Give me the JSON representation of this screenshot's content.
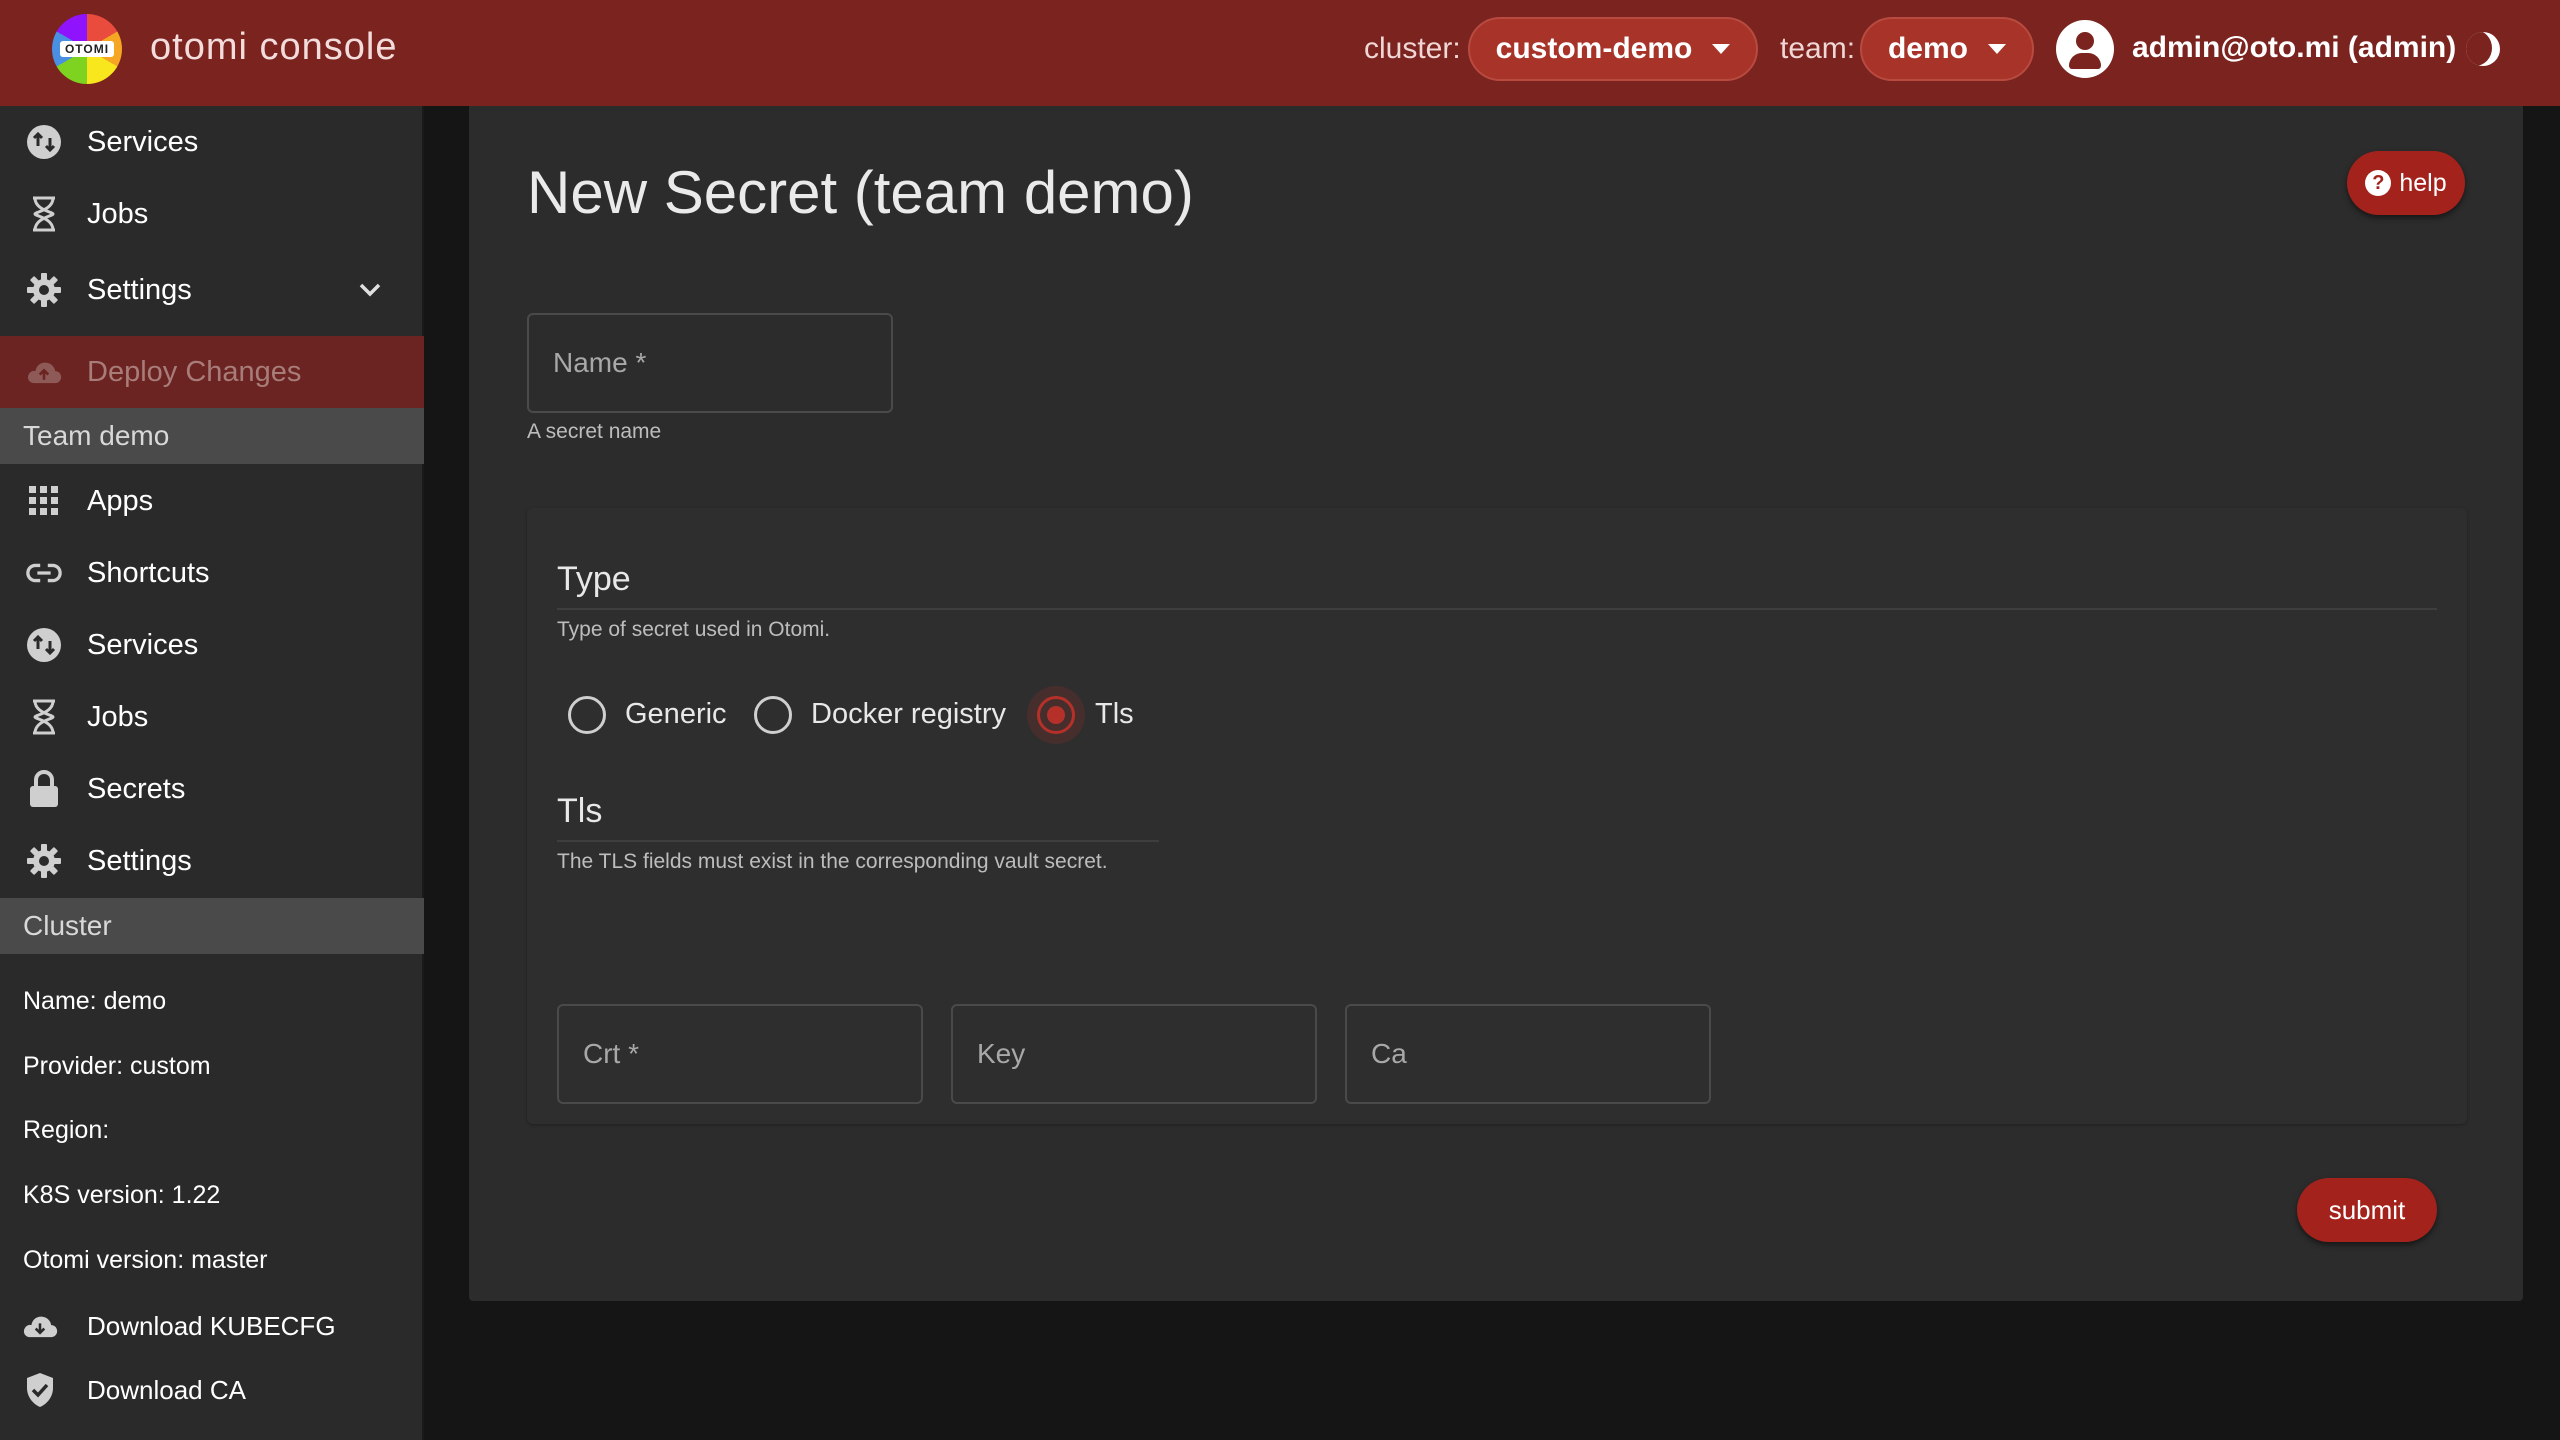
{
  "app": {
    "logo_text": "OTOMI",
    "title": "otomi console"
  },
  "topbar": {
    "cluster_label": "cluster:",
    "cluster_value": "custom-demo",
    "team_label": "team:",
    "team_value": "demo",
    "user": "admin@oto.mi (admin)"
  },
  "sidebar": {
    "top_items": [
      {
        "label": "Services",
        "icon": "services-icon"
      },
      {
        "label": "Jobs",
        "icon": "hourglass-icon"
      },
      {
        "label": "Settings",
        "icon": "gear-icon"
      }
    ],
    "deploy_label": "Deploy Changes",
    "team_section": "Team demo",
    "team_items": [
      {
        "label": "Apps",
        "icon": "apps-grid-icon"
      },
      {
        "label": "Shortcuts",
        "icon": "link-icon"
      },
      {
        "label": "Services",
        "icon": "services-icon"
      },
      {
        "label": "Jobs",
        "icon": "hourglass-icon"
      },
      {
        "label": "Secrets",
        "icon": "lock-icon"
      },
      {
        "label": "Settings",
        "icon": "gear-icon"
      }
    ],
    "cluster_section": "Cluster",
    "cluster_info": [
      "Name: demo",
      "Provider: custom",
      "Region:",
      "K8S version: 1.22",
      "Otomi version: master"
    ],
    "downloads": [
      {
        "label": "Download KUBECFG",
        "icon": "cloud-download-icon"
      },
      {
        "label": "Download CA",
        "icon": "shield-check-icon"
      }
    ]
  },
  "main": {
    "title": "New Secret (team demo)",
    "help_label": "help",
    "name_field": {
      "label": "Name *",
      "helper": "A secret name"
    },
    "type_section": {
      "legend": "Type",
      "description": "Type of secret used in Otomi.",
      "options": [
        "Generic",
        "Docker registry",
        "Tls"
      ],
      "selected": "Tls"
    },
    "tls_section": {
      "legend": "Tls",
      "description": "The TLS fields must exist in the corresponding vault secret.",
      "fields": [
        "Crt *",
        "Key",
        "Ca"
      ]
    },
    "submit_label": "submit"
  },
  "colors": {
    "topbar": "#7a231f",
    "accent": "#a4221c",
    "sidebar": "#2a2a2a",
    "card": "#2c2c2c",
    "background": "#151515"
  }
}
